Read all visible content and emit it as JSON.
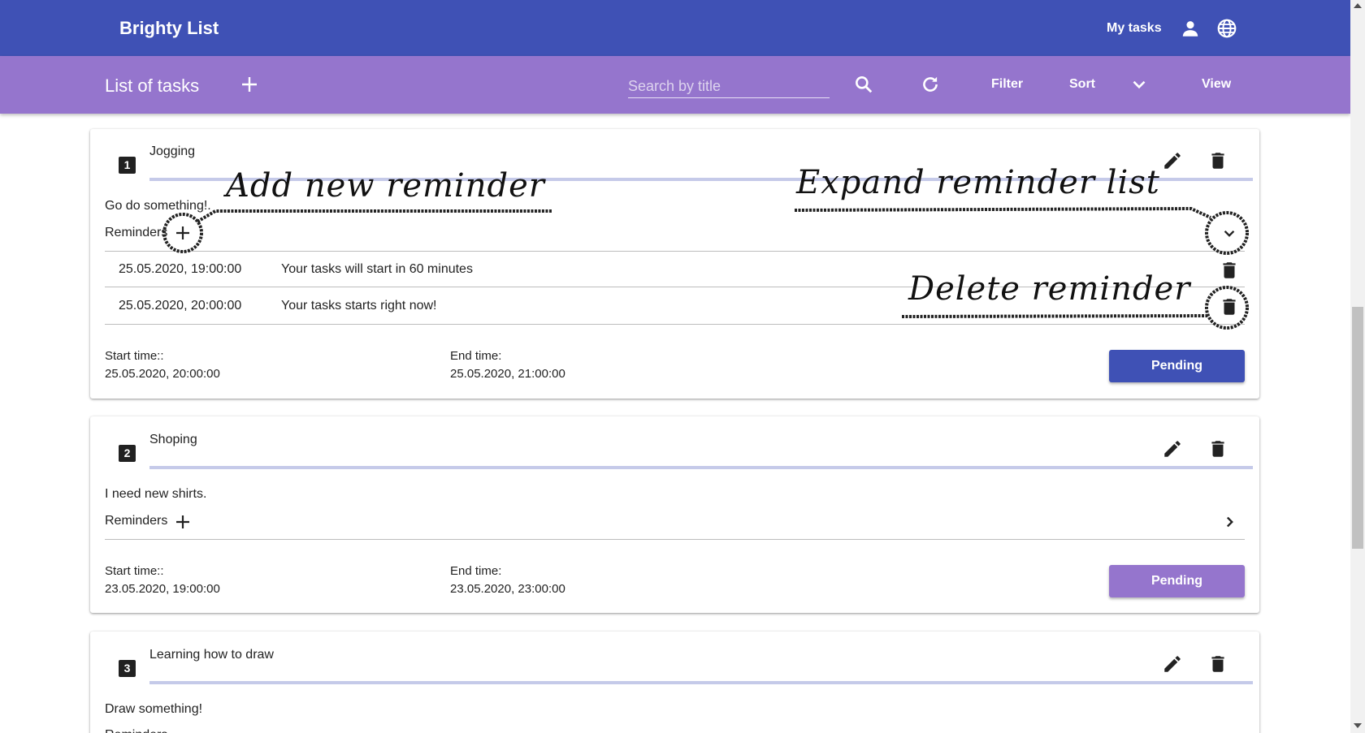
{
  "header": {
    "brand": "Brighty List",
    "my_tasks": "My tasks",
    "icons": [
      "person-icon",
      "globe-icon"
    ]
  },
  "toolbar": {
    "title": "List of tasks",
    "search_placeholder": "Search by title",
    "filter": "Filter",
    "sort": "Sort",
    "view": "View"
  },
  "labels": {
    "reminders": "Reminders",
    "start_time": "Start time::",
    "end_time": "End time:"
  },
  "tasks": [
    {
      "number": "1",
      "title": "Jogging",
      "description": "Go do something!.",
      "reminders_expanded": true,
      "reminders": [
        {
          "time": "25.05.2020, 19:00:00",
          "message": "Your tasks will start in 60 minutes"
        },
        {
          "time": "25.05.2020, 20:00:00",
          "message": "Your tasks starts right now!"
        }
      ],
      "start_time": "25.05.2020, 20:00:00",
      "end_time": "25.05.2020, 21:00:00",
      "status": "Pending",
      "status_color": "#3f51b5"
    },
    {
      "number": "2",
      "title": "Shoping",
      "description": "I need new shirts.",
      "reminders_expanded": false,
      "reminders": [],
      "start_time": "23.05.2020, 19:00:00",
      "end_time": "23.05.2020, 23:00:00",
      "status": "Pending",
      "status_color": "#9575cd"
    },
    {
      "number": "3",
      "title": "Learning how to draw",
      "description": "Draw something!",
      "reminders_expanded": false
    }
  ],
  "annotations": {
    "add_reminder": "Add new reminder",
    "expand_list": "Expand reminder list",
    "delete_reminder": "Delete reminder"
  },
  "colors": {
    "primary": "#3f51b5",
    "secondary": "#9575cd",
    "title_underline": "#c5cae9"
  }
}
